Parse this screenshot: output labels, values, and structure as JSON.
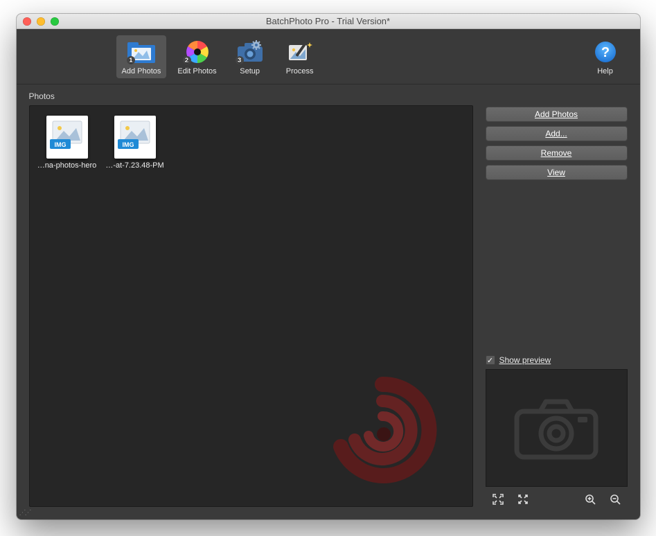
{
  "window": {
    "title": "BatchPhoto Pro - Trial Version*"
  },
  "toolbar": {
    "items": [
      {
        "label": "Add Photos",
        "step": "1"
      },
      {
        "label": "Edit Photos",
        "step": "2"
      },
      {
        "label": "Setup",
        "step": "3"
      },
      {
        "label": "Process",
        "step": ""
      }
    ],
    "help_label": "Help"
  },
  "main": {
    "section_title": "Photos",
    "thumbs": [
      {
        "caption": "…na-photos-hero"
      },
      {
        "caption": "…-at-7.23.48-PM"
      }
    ]
  },
  "sidebar": {
    "buttons": [
      {
        "label": "Add Photos"
      },
      {
        "label": "Add..."
      },
      {
        "label": "Remove"
      },
      {
        "label": "View"
      }
    ],
    "preview_check_label": "Show preview",
    "preview_checked": true
  }
}
